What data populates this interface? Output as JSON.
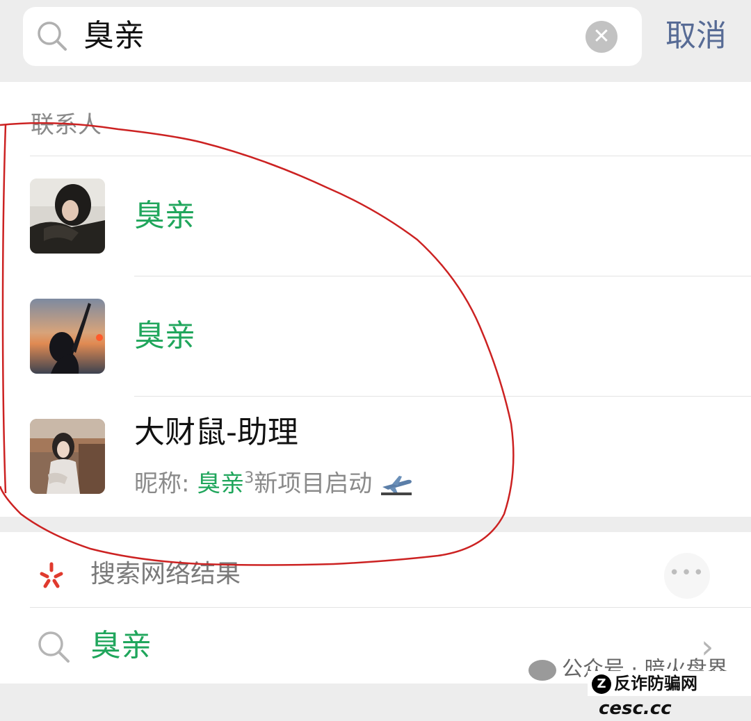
{
  "search": {
    "query": "臭亲",
    "cancel_label": "取消"
  },
  "contacts_section": {
    "title": "联系人",
    "items": [
      {
        "name": "臭亲",
        "highlight": true
      },
      {
        "name": "臭亲",
        "highlight": true
      },
      {
        "name": "大财鼠-助理",
        "nickname_prefix": "昵称: ",
        "nickname_match": "臭亲",
        "nickname_suffix_sup": "3",
        "nickname_rest": "新项目启动"
      }
    ]
  },
  "web_search": {
    "label": "搜索网络结果",
    "more_label": "•••",
    "query": "臭亲"
  },
  "watermark": {
    "text": "公众号 · 暗火盘界",
    "site_name": "反诈防骗网",
    "site_domain": "cesc.cc"
  },
  "colors": {
    "match_green": "#20a65c",
    "link_blue": "#576b95",
    "annotation_red": "#cc2222"
  }
}
